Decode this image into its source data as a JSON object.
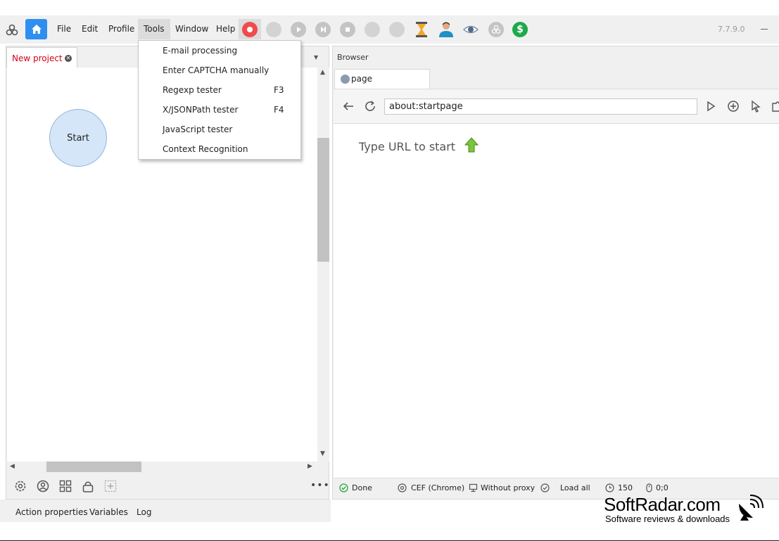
{
  "toolbar": {
    "menu": [
      "File",
      "Edit",
      "Profile",
      "Tools",
      "Window",
      "Help"
    ],
    "version": "7.7.9.0"
  },
  "tools_menu": {
    "items": [
      {
        "label": "E-mail processing",
        "shortcut": ""
      },
      {
        "label": "Enter CAPTCHA manually",
        "shortcut": ""
      },
      {
        "label": "Regexp tester",
        "shortcut": "F3"
      },
      {
        "label": "X/JSONPath tester",
        "shortcut": "F4"
      },
      {
        "label": "JavaScript tester",
        "shortcut": ""
      },
      {
        "label": "Context Recognition",
        "shortcut": ""
      }
    ]
  },
  "project": {
    "tab_label": "New project",
    "start_node": "Start"
  },
  "bottom_tabs": [
    "Action properties",
    "Variables",
    "Log"
  ],
  "browser": {
    "title": "Browser",
    "tab_label": "page",
    "url": "about:startpage",
    "start_hint": "Type URL to start",
    "status": {
      "done": "Done",
      "engine": "CEF (Chrome)",
      "proxy": "Without proxy",
      "load": "Load all",
      "timeout": "150",
      "mouse": "0;0"
    }
  },
  "watermark": {
    "title": "SoftRadar.com",
    "subtitle": "Software reviews & downloads"
  },
  "colors": {
    "accent": "#2f8ff0",
    "record": "#ee4b4b",
    "tab_text": "#d0021b",
    "start_node": "#d4e6f7"
  }
}
